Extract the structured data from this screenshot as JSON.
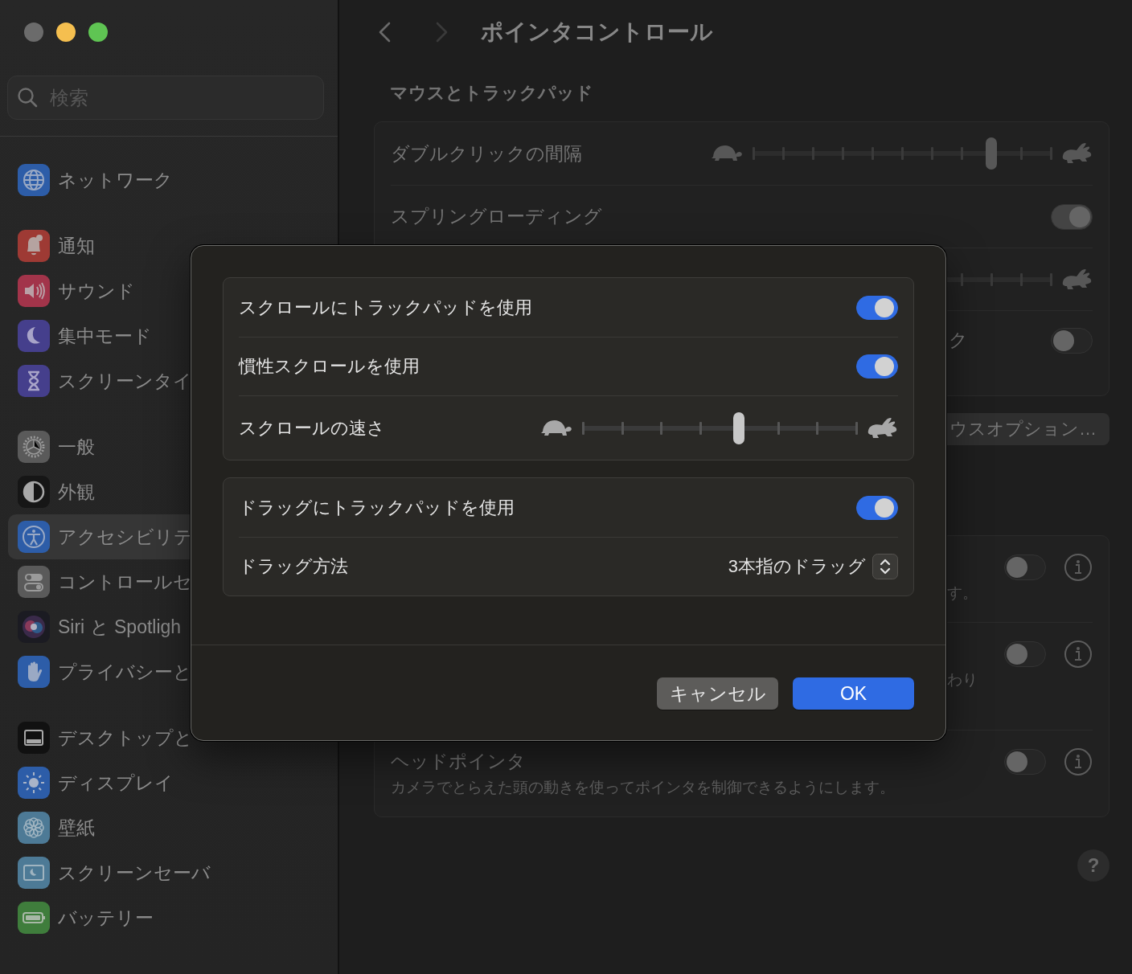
{
  "window": {
    "controls": [
      {
        "color": "#6b6b6b"
      },
      {
        "color": "#f5bf4f"
      },
      {
        "color": "#5fc453"
      }
    ]
  },
  "sidebar": {
    "search": {
      "placeholder": "検索"
    },
    "groups": [
      {
        "items": [
          {
            "label": "ネットワーク",
            "selected": false
          }
        ]
      },
      {
        "items": [
          {
            "label": "通知",
            "selected": false
          },
          {
            "label": "サウンド",
            "selected": false
          },
          {
            "label": "集中モード",
            "selected": false
          },
          {
            "label": "スクリーンタイ",
            "selected": false
          }
        ]
      },
      {
        "items": [
          {
            "label": "一般",
            "selected": false
          },
          {
            "label": "外観",
            "selected": false
          },
          {
            "label": "アクセシビリテ",
            "selected": true
          },
          {
            "label": "コントロールセ",
            "selected": false
          },
          {
            "label": "Siri と Spotligh",
            "selected": false
          },
          {
            "label": "プライバシーと",
            "selected": false
          }
        ]
      },
      {
        "items": [
          {
            "label": "デスクトップと",
            "selected": false
          },
          {
            "label": "ディスプレイ",
            "selected": false
          },
          {
            "label": "壁紙",
            "selected": false
          },
          {
            "label": "スクリーンセーバ",
            "selected": false
          },
          {
            "label": "バッテリー",
            "selected": false
          }
        ]
      }
    ]
  },
  "main": {
    "nav": [
      {
        "kind": "back",
        "disabled": false
      },
      {
        "kind": "forward",
        "disabled": true
      }
    ],
    "title": "ポインタコントロール",
    "section_title": "マウスとトラックパッド",
    "card_1": [
      {
        "kind": "slider",
        "label": "ダブルクリックの間隔",
        "level": 0.8
      },
      {
        "kind": "toggle",
        "label": "スプリングローディング",
        "on": true
      },
      {
        "kind": "slider"
      },
      {
        "kind": "toggle",
        "label_tail": "ク",
        "on": false
      }
    ],
    "options_button": "ウスオプション…",
    "card_2": [
      {
        "description_tail": "す。",
        "on": false
      },
      {
        "description_tail": "わり",
        "on": false
      },
      {
        "label": "ヘッドポインタ",
        "description": "カメラでとらえた頭の動きを使ってポインタを制御できるようにします。",
        "on": false
      }
    ],
    "help_button": "?"
  },
  "sheet": {
    "groups": [
      {
        "rows": [
          {
            "kind": "toggle",
            "label": "スクロールにトラックパッドを使用",
            "on": true
          },
          {
            "kind": "toggle",
            "label": "慣性スクロールを使用",
            "on": true
          },
          {
            "kind": "slider",
            "label": "スクロールの速さ",
            "level": 0.57
          }
        ]
      },
      {
        "rows": [
          {
            "kind": "toggle",
            "label": "ドラッグにトラックパッドを使用",
            "on": true
          },
          {
            "kind": "popup",
            "label": "ドラッグ方法",
            "value": "3本指のドラッグ"
          }
        ]
      }
    ],
    "buttons": [
      {
        "label": "キャンセル",
        "default": false
      },
      {
        "label": "OK",
        "default": true
      }
    ]
  }
}
